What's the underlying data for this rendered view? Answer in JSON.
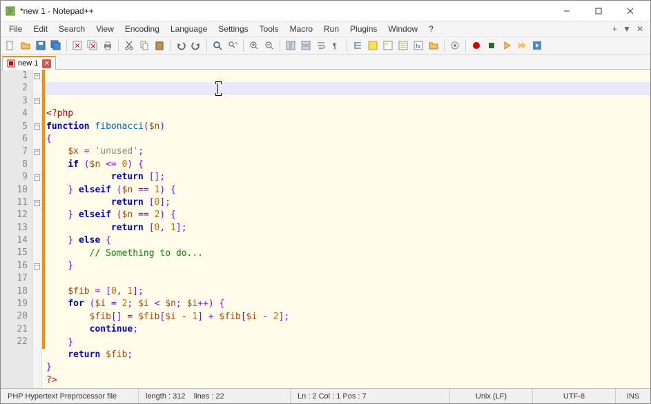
{
  "window": {
    "title": "*new 1 - Notepad++"
  },
  "menus": [
    "File",
    "Edit",
    "Search",
    "View",
    "Encoding",
    "Language",
    "Settings",
    "Tools",
    "Macro",
    "Run",
    "Plugins",
    "Window",
    "?"
  ],
  "tab": {
    "label": "new 1"
  },
  "lineCount": 22,
  "caret": {
    "line": 2,
    "afterCharX": 250
  },
  "code": [
    {
      "indent": 0,
      "tokens": [
        {
          "t": "<?php",
          "c": "k-tag"
        }
      ]
    },
    {
      "indent": 0,
      "tokens": [
        {
          "t": "function",
          "c": "k-key"
        },
        {
          "t": " "
        },
        {
          "t": "fibonacci",
          "c": "k-func"
        },
        {
          "t": "(",
          "c": "k-brace"
        },
        {
          "t": "$n",
          "c": "k-var"
        },
        {
          "t": ")",
          "c": "k-brace"
        }
      ]
    },
    {
      "indent": 0,
      "tokens": [
        {
          "t": "{",
          "c": "k-brace"
        }
      ]
    },
    {
      "indent": 1,
      "tokens": [
        {
          "t": "$x",
          "c": "k-var"
        },
        {
          "t": " "
        },
        {
          "t": "=",
          "c": "k-op"
        },
        {
          "t": " "
        },
        {
          "t": "'unused'",
          "c": "k-str"
        },
        {
          "t": ";",
          "c": "k-punc"
        }
      ]
    },
    {
      "indent": 1,
      "tokens": [
        {
          "t": "if",
          "c": "k-key"
        },
        {
          "t": " "
        },
        {
          "t": "(",
          "c": "k-brace"
        },
        {
          "t": "$n",
          "c": "k-var"
        },
        {
          "t": " "
        },
        {
          "t": "<=",
          "c": "k-op"
        },
        {
          "t": " "
        },
        {
          "t": "0",
          "c": "k-num"
        },
        {
          "t": ")",
          "c": "k-brace"
        },
        {
          "t": " "
        },
        {
          "t": "{",
          "c": "k-brace"
        }
      ]
    },
    {
      "indent": 3,
      "tokens": [
        {
          "t": "return",
          "c": "k-key"
        },
        {
          "t": " "
        },
        {
          "t": "[",
          "c": "k-brace"
        },
        {
          "t": "]",
          "c": "k-brace"
        },
        {
          "t": ";",
          "c": "k-punc"
        }
      ]
    },
    {
      "indent": 1,
      "tokens": [
        {
          "t": "}",
          "c": "k-brace"
        },
        {
          "t": " "
        },
        {
          "t": "elseif",
          "c": "k-key"
        },
        {
          "t": " "
        },
        {
          "t": "(",
          "c": "k-brace"
        },
        {
          "t": "$n",
          "c": "k-var"
        },
        {
          "t": " "
        },
        {
          "t": "==",
          "c": "k-op"
        },
        {
          "t": " "
        },
        {
          "t": "1",
          "c": "k-num"
        },
        {
          "t": ")",
          "c": "k-brace"
        },
        {
          "t": " "
        },
        {
          "t": "{",
          "c": "k-brace"
        }
      ]
    },
    {
      "indent": 3,
      "tokens": [
        {
          "t": "return",
          "c": "k-key"
        },
        {
          "t": " "
        },
        {
          "t": "[",
          "c": "k-brace"
        },
        {
          "t": "0",
          "c": "k-num"
        },
        {
          "t": "]",
          "c": "k-brace"
        },
        {
          "t": ";",
          "c": "k-punc"
        }
      ]
    },
    {
      "indent": 1,
      "tokens": [
        {
          "t": "}",
          "c": "k-brace"
        },
        {
          "t": " "
        },
        {
          "t": "elseif",
          "c": "k-key"
        },
        {
          "t": " "
        },
        {
          "t": "(",
          "c": "k-brace"
        },
        {
          "t": "$n",
          "c": "k-var"
        },
        {
          "t": " "
        },
        {
          "t": "==",
          "c": "k-op"
        },
        {
          "t": " "
        },
        {
          "t": "2",
          "c": "k-num"
        },
        {
          "t": ")",
          "c": "k-brace"
        },
        {
          "t": " "
        },
        {
          "t": "{",
          "c": "k-brace"
        }
      ]
    },
    {
      "indent": 3,
      "tokens": [
        {
          "t": "return",
          "c": "k-key"
        },
        {
          "t": " "
        },
        {
          "t": "[",
          "c": "k-brace"
        },
        {
          "t": "0",
          "c": "k-num"
        },
        {
          "t": ",",
          "c": "k-punc"
        },
        {
          "t": " "
        },
        {
          "t": "1",
          "c": "k-num"
        },
        {
          "t": "]",
          "c": "k-brace"
        },
        {
          "t": ";",
          "c": "k-punc"
        }
      ]
    },
    {
      "indent": 1,
      "tokens": [
        {
          "t": "}",
          "c": "k-brace"
        },
        {
          "t": " "
        },
        {
          "t": "else",
          "c": "k-key"
        },
        {
          "t": " "
        },
        {
          "t": "{",
          "c": "k-brace"
        }
      ]
    },
    {
      "indent": 2,
      "tokens": [
        {
          "t": "// Something to do...",
          "c": "k-comment"
        }
      ]
    },
    {
      "indent": 1,
      "tokens": [
        {
          "t": "}",
          "c": "k-brace"
        }
      ]
    },
    {
      "indent": 0,
      "tokens": []
    },
    {
      "indent": 1,
      "tokens": [
        {
          "t": "$fib",
          "c": "k-var"
        },
        {
          "t": " "
        },
        {
          "t": "=",
          "c": "k-op"
        },
        {
          "t": " "
        },
        {
          "t": "[",
          "c": "k-brace"
        },
        {
          "t": "0",
          "c": "k-num"
        },
        {
          "t": ",",
          "c": "k-punc"
        },
        {
          "t": " "
        },
        {
          "t": "1",
          "c": "k-num"
        },
        {
          "t": "]",
          "c": "k-brace"
        },
        {
          "t": ";",
          "c": "k-punc"
        }
      ]
    },
    {
      "indent": 1,
      "tokens": [
        {
          "t": "for",
          "c": "k-key"
        },
        {
          "t": " "
        },
        {
          "t": "(",
          "c": "k-brace"
        },
        {
          "t": "$i",
          "c": "k-var"
        },
        {
          "t": " "
        },
        {
          "t": "=",
          "c": "k-op"
        },
        {
          "t": " "
        },
        {
          "t": "2",
          "c": "k-num"
        },
        {
          "t": ";",
          "c": "k-punc"
        },
        {
          "t": " "
        },
        {
          "t": "$i",
          "c": "k-var"
        },
        {
          "t": " "
        },
        {
          "t": "<",
          "c": "k-op"
        },
        {
          "t": " "
        },
        {
          "t": "$n",
          "c": "k-var"
        },
        {
          "t": ";",
          "c": "k-punc"
        },
        {
          "t": " "
        },
        {
          "t": "$i",
          "c": "k-var"
        },
        {
          "t": "++",
          "c": "k-op"
        },
        {
          "t": ")",
          "c": "k-brace"
        },
        {
          "t": " "
        },
        {
          "t": "{",
          "c": "k-brace"
        }
      ]
    },
    {
      "indent": 2,
      "tokens": [
        {
          "t": "$fib",
          "c": "k-var"
        },
        {
          "t": "[",
          "c": "k-brace"
        },
        {
          "t": "]",
          "c": "k-brace"
        },
        {
          "t": " "
        },
        {
          "t": "=",
          "c": "k-op"
        },
        {
          "t": " "
        },
        {
          "t": "$fib",
          "c": "k-var"
        },
        {
          "t": "[",
          "c": "k-brace"
        },
        {
          "t": "$i",
          "c": "k-var"
        },
        {
          "t": " "
        },
        {
          "t": "-",
          "c": "k-op"
        },
        {
          "t": " "
        },
        {
          "t": "1",
          "c": "k-num"
        },
        {
          "t": "]",
          "c": "k-brace"
        },
        {
          "t": " "
        },
        {
          "t": "+",
          "c": "k-op"
        },
        {
          "t": " "
        },
        {
          "t": "$fib",
          "c": "k-var"
        },
        {
          "t": "[",
          "c": "k-brace"
        },
        {
          "t": "$i",
          "c": "k-var"
        },
        {
          "t": " "
        },
        {
          "t": "-",
          "c": "k-op"
        },
        {
          "t": " "
        },
        {
          "t": "2",
          "c": "k-num"
        },
        {
          "t": "]",
          "c": "k-brace"
        },
        {
          "t": ";",
          "c": "k-punc"
        }
      ]
    },
    {
      "indent": 2,
      "tokens": [
        {
          "t": "continue",
          "c": "k-key"
        },
        {
          "t": ";",
          "c": "k-punc"
        }
      ]
    },
    {
      "indent": 1,
      "tokens": [
        {
          "t": "}",
          "c": "k-brace"
        }
      ]
    },
    {
      "indent": 1,
      "tokens": [
        {
          "t": "return",
          "c": "k-key"
        },
        {
          "t": " "
        },
        {
          "t": "$fib",
          "c": "k-var"
        },
        {
          "t": ";",
          "c": "k-punc"
        }
      ]
    },
    {
      "indent": 0,
      "tokens": [
        {
          "t": "}",
          "c": "k-brace"
        }
      ]
    },
    {
      "indent": 0,
      "tokens": [
        {
          "t": "?>",
          "c": "k-tag"
        }
      ]
    }
  ],
  "foldMarks": {
    "1": "minus",
    "3": "minus",
    "5": "minus",
    "7": "minus",
    "9": "minus",
    "11": "minus",
    "16": "minus"
  },
  "changeMarks": [
    1,
    2,
    3,
    4,
    5,
    6,
    7,
    8,
    9,
    10,
    11,
    12,
    13,
    14,
    15,
    16,
    17,
    18,
    19,
    20,
    21,
    22
  ],
  "status": {
    "filetype": "PHP Hypertext Preprocessor file",
    "length": "length : 312",
    "lines": "lines : 22",
    "pos": "Ln : 2    Col : 1    Pos : 7",
    "sel": "",
    "eol": "Unix (LF)",
    "enc": "UTF-8",
    "ins": "INS"
  }
}
